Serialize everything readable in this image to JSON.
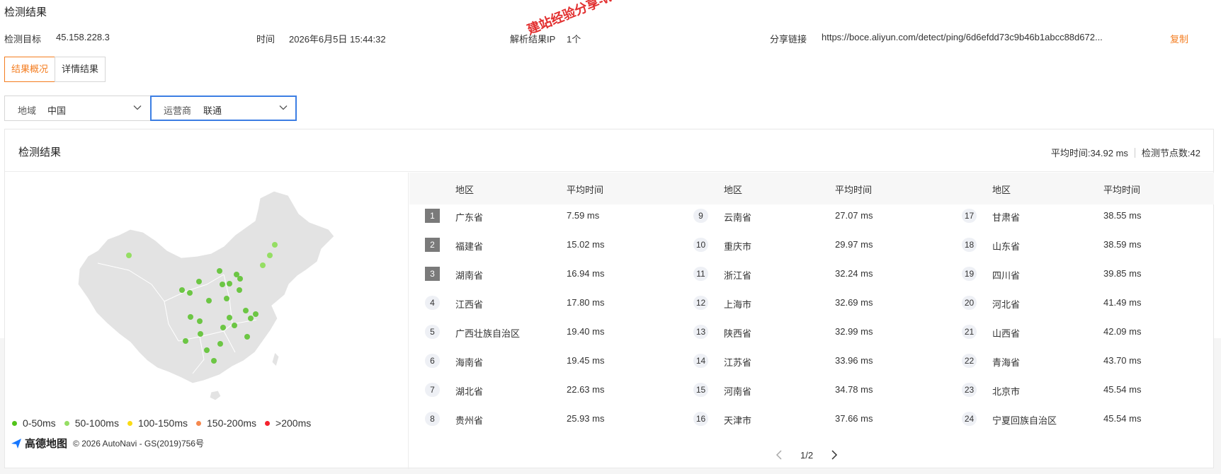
{
  "page_title": "检测结果",
  "meta": {
    "target_label": "检测目标",
    "target_value": "45.158.228.3",
    "time_label": "时间",
    "time_value": "2026年6月5日 15:44:32",
    "resolve_label": "解析结果IP",
    "resolve_value": "1个",
    "share_label": "分享链接",
    "share_value": "https://boce.aliyun.com/detect/ping/6d6efdd73c9b46b1abcc88d672...",
    "copy_label": "复制"
  },
  "watermark": "建站经验分享-www.w",
  "tabs": [
    {
      "label": "结果概况",
      "active": true
    },
    {
      "label": "详情结果",
      "active": false
    }
  ],
  "filters": {
    "region": {
      "label": "地域",
      "value": "中国"
    },
    "isp": {
      "label": "运营商",
      "value": "联通"
    }
  },
  "panel": {
    "title": "检测结果",
    "avg_time": "平均时间:34.92 ms",
    "node_count": "检测节点数:42"
  },
  "legend": [
    {
      "label": "0-50ms",
      "color": "#52c41a"
    },
    {
      "label": "50-100ms",
      "color": "#95de64"
    },
    {
      "label": "100-150ms",
      "color": "#fadb14"
    },
    {
      "label": "150-200ms",
      "color": "#f5884e"
    },
    {
      "label": ">200ms",
      "color": "#f5222d"
    }
  ],
  "attribution": {
    "logo": "高德地图",
    "text": "© 2026 AutoNavi - GS(2019)756号"
  },
  "table": {
    "col_region": "地区",
    "col_avg": "平均时间",
    "rows": [
      {
        "rank": "1",
        "region": "广东省",
        "avg": "7.59 ms"
      },
      {
        "rank": "2",
        "region": "福建省",
        "avg": "15.02 ms"
      },
      {
        "rank": "3",
        "region": "湖南省",
        "avg": "16.94 ms"
      },
      {
        "rank": "4",
        "region": "江西省",
        "avg": "17.80 ms"
      },
      {
        "rank": "5",
        "region": "广西壮族自治区",
        "avg": "19.40 ms"
      },
      {
        "rank": "6",
        "region": "海南省",
        "avg": "19.45 ms"
      },
      {
        "rank": "7",
        "region": "湖北省",
        "avg": "22.63 ms"
      },
      {
        "rank": "8",
        "region": "贵州省",
        "avg": "25.93 ms"
      },
      {
        "rank": "9",
        "region": "云南省",
        "avg": "27.07 ms"
      },
      {
        "rank": "10",
        "region": "重庆市",
        "avg": "29.97 ms"
      },
      {
        "rank": "11",
        "region": "浙江省",
        "avg": "32.24 ms"
      },
      {
        "rank": "12",
        "region": "上海市",
        "avg": "32.69 ms"
      },
      {
        "rank": "13",
        "region": "陕西省",
        "avg": "32.99 ms"
      },
      {
        "rank": "14",
        "region": "江苏省",
        "avg": "33.96 ms"
      },
      {
        "rank": "15",
        "region": "河南省",
        "avg": "34.78 ms"
      },
      {
        "rank": "16",
        "region": "天津市",
        "avg": "37.66 ms"
      },
      {
        "rank": "17",
        "region": "甘肃省",
        "avg": "38.55 ms"
      },
      {
        "rank": "18",
        "region": "山东省",
        "avg": "38.59 ms"
      },
      {
        "rank": "19",
        "region": "四川省",
        "avg": "39.85 ms"
      },
      {
        "rank": "20",
        "region": "河北省",
        "avg": "41.49 ms"
      },
      {
        "rank": "21",
        "region": "山西省",
        "avg": "42.09 ms"
      },
      {
        "rank": "22",
        "region": "青海省",
        "avg": "43.70 ms"
      },
      {
        "rank": "23",
        "region": "北京市",
        "avg": "45.54 ms"
      },
      {
        "rank": "24",
        "region": "宁夏回族自治区",
        "avg": "45.54 ms"
      }
    ]
  },
  "pager": {
    "text": "1/2"
  },
  "colors": {
    "accent": "#f47d20",
    "focus": "#3c7ee3",
    "node": "#6cc644"
  }
}
